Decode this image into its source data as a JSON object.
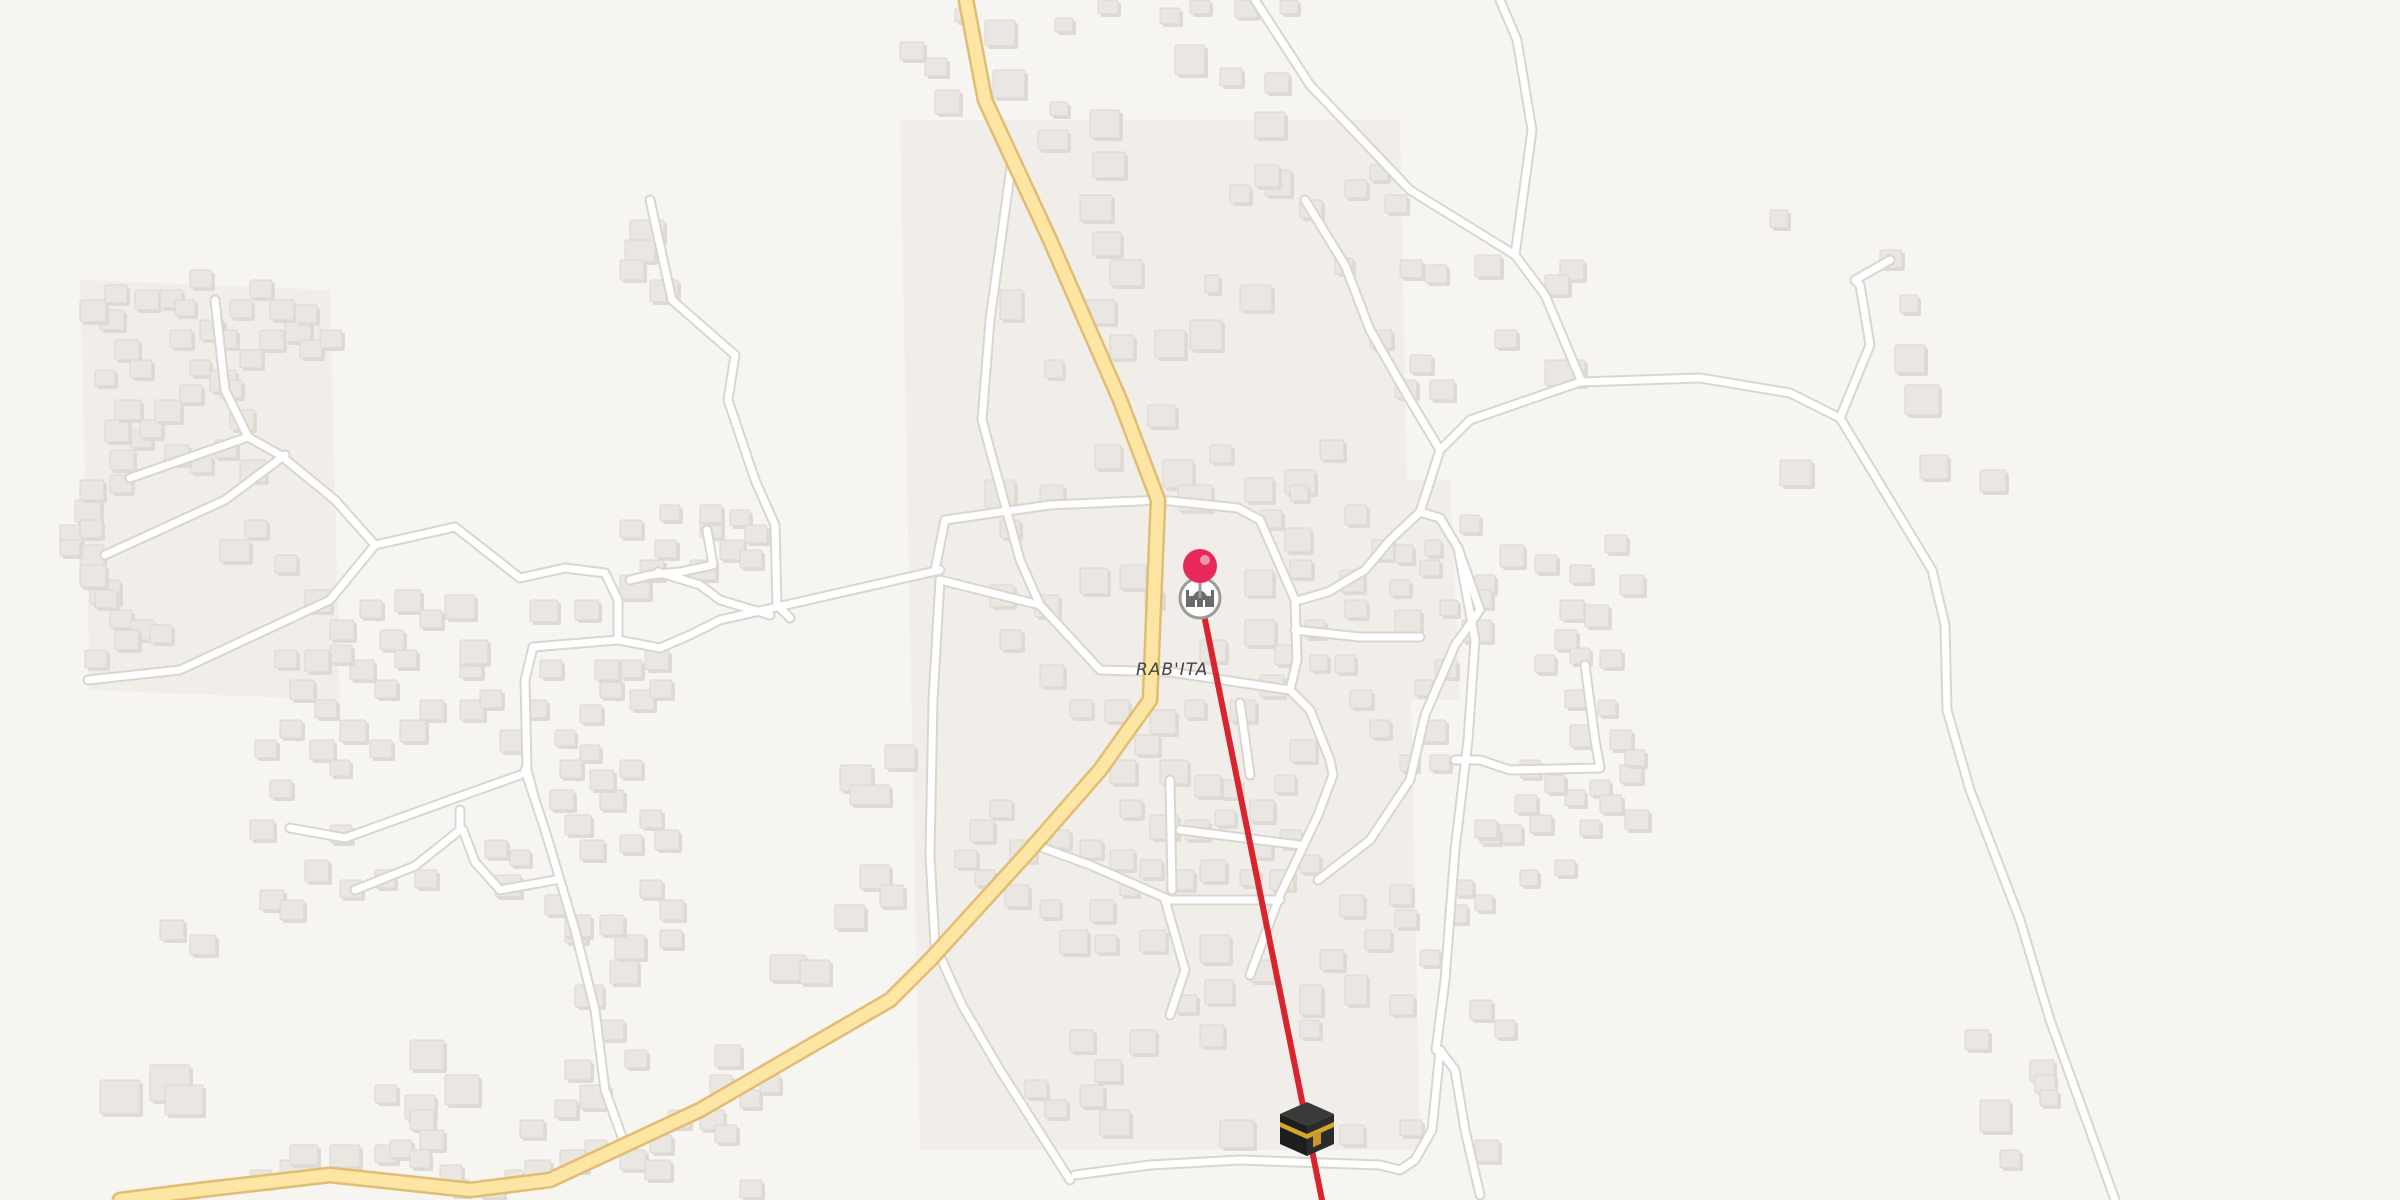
{
  "map": {
    "place_label": "RAB'ITA",
    "colors": {
      "background": "#f7f5f2",
      "minor_road": "#ffffff",
      "main_road": "#fde6a4",
      "main_road_casing": "#e1bd73",
      "route_line": "#d9232e",
      "pin": "#e8285a",
      "building": "#eae6e1"
    },
    "markers": {
      "origin_pin_icon": "map-pin-icon",
      "mosque_icon": "mosque-icon",
      "kaaba_icon": "kaaba-icon"
    },
    "route": {
      "type": "qibla-direction-line"
    }
  }
}
